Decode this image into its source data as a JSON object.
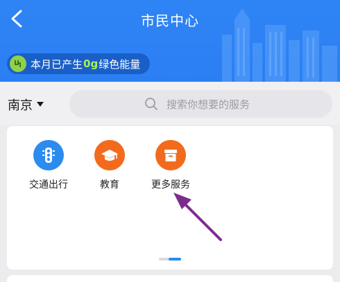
{
  "header": {
    "title": "市民中心",
    "energy_prefix": "本月已产生",
    "energy_amount": "0g",
    "energy_suffix": "绿色能量",
    "bg_color": "#2f84f5",
    "energy_accent": "#a6f05a"
  },
  "location": {
    "city": "南京"
  },
  "search": {
    "placeholder": "搜索你想要的服务"
  },
  "services": [
    {
      "label": "交通出行",
      "icon": "traffic-light-icon",
      "color": "#2b8cf0"
    },
    {
      "label": "教育",
      "icon": "graduation-cap-icon",
      "color": "#f26b1d"
    },
    {
      "label": "更多服务",
      "icon": "box-icon",
      "color": "#f26b1d"
    }
  ],
  "annotation_color": "#7b2d8e"
}
